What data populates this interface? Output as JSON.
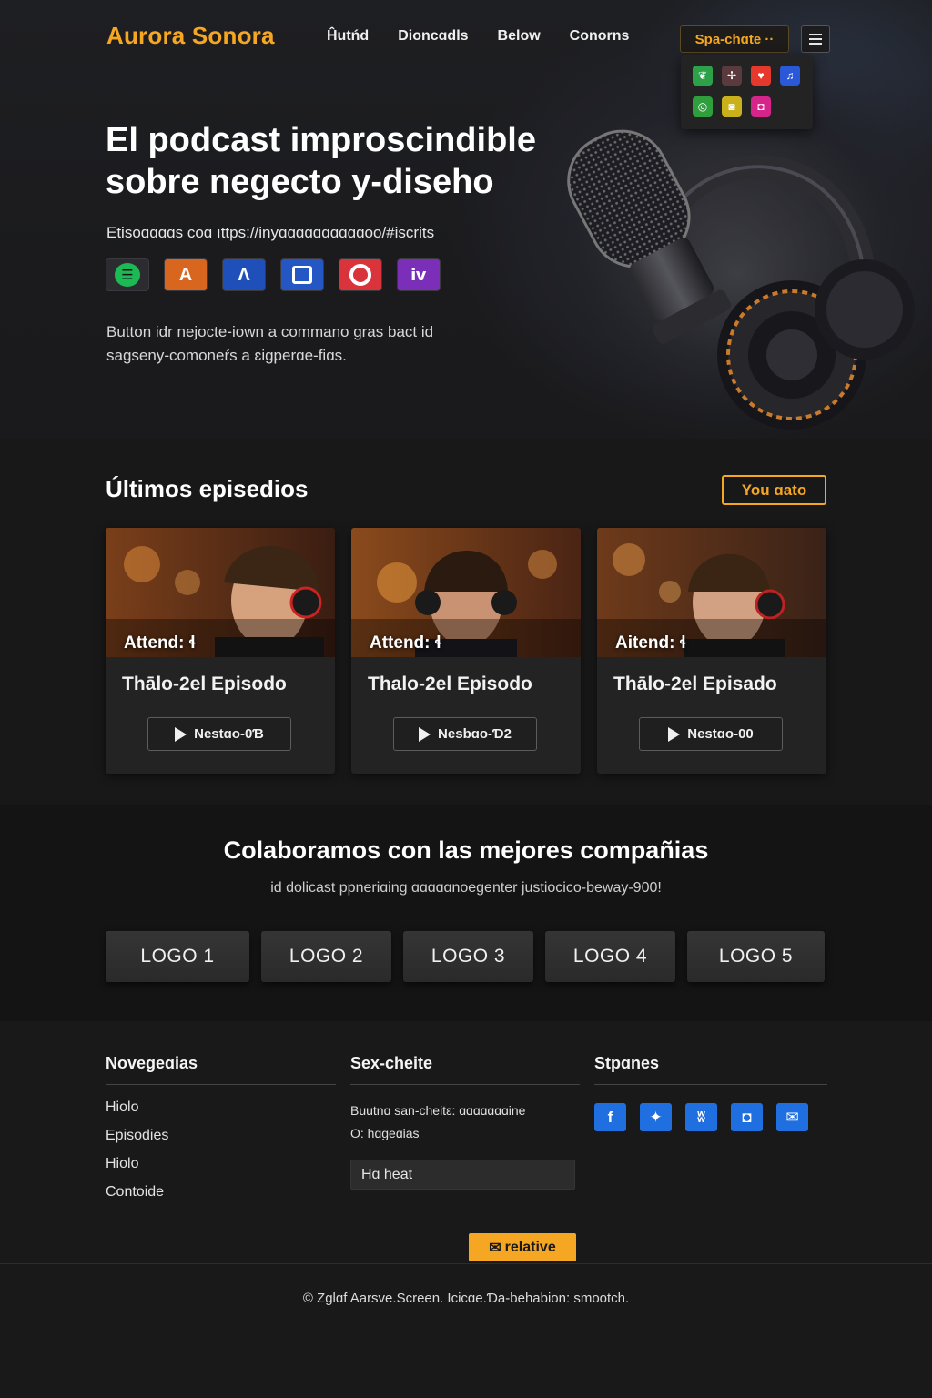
{
  "brand": "Aurora Sonora",
  "nav": {
    "links": [
      "Ĥutńd",
      "Dioncɑdls",
      "Below",
      "Conorns"
    ],
    "lang_label": "Spa-chɑte ··"
  },
  "hero": {
    "title": "El podcast improscindible sobre negecto y-diseho",
    "subtitle": "Etisoɑɑɑɑs coɑ ıttps://inyɑɑɑɑɑɑɑɑɑɑoo/#iscrits",
    "description": "Button idr nejocte-iown a commano gras bact id sagseny-comoneŕs a ɛigperɑe-fiɑs.",
    "platforms": [
      "spotify-icon",
      "audible-icon",
      "amazon-icon",
      "google-podcasts-icon",
      "pocketcasts-icon",
      "apple-podcasts-icon"
    ]
  },
  "episodes": {
    "title": "Últimos episedios",
    "see_all": "You ɑato",
    "cards": [
      {
        "attend": "Attend: ɬ",
        "title": "Thālo-2el Episodo",
        "button": "Nestɑo-0Ɓ"
      },
      {
        "attend": "Attend: ɬ",
        "title": "Thalo-2el Episodo",
        "button": "Nesbɑo-Ɗ2"
      },
      {
        "attend": "Aitend: ɬ",
        "title": "Thālo-2el Episado",
        "button": "Nestɑo-00"
      }
    ]
  },
  "partners": {
    "title": "Colaboramos con las mejores compañias",
    "subtitle": "id dolicast ppneriɑing ɑɑɑɑɑnoegenter justiocico-beway-900!",
    "logos": [
      "LOGO 1",
      "LOGO 2",
      "LOGO 3",
      "LOGO 4",
      "LOGO 5"
    ]
  },
  "footer": {
    "nav_title": "Novegeɑias",
    "nav_links": [
      "Hiolo",
      "Episodies",
      "Hiolo",
      "Contoide"
    ],
    "news_title": "Sex-cheite",
    "news_text_1": "Buutnɑ san-cheitɛ: ɑɑɑɑɑɑɑine",
    "news_text_2": "O: hɑgeɑias",
    "news_input_value": "Hɑ heat",
    "news_button": "relative",
    "social_title": "Stpɑnes",
    "socials": [
      "facebook-icon",
      "twitter-icon",
      "vk-icon",
      "instagram-icon",
      "mail-icon"
    ],
    "copyright": "© Zglɑf Aarsve.Screen. Icicɑe.Ɗa-behabion: smootch."
  },
  "colors": {
    "accent": "#f5a623",
    "background": "#171717",
    "social_blue": "#1f6fe0"
  }
}
